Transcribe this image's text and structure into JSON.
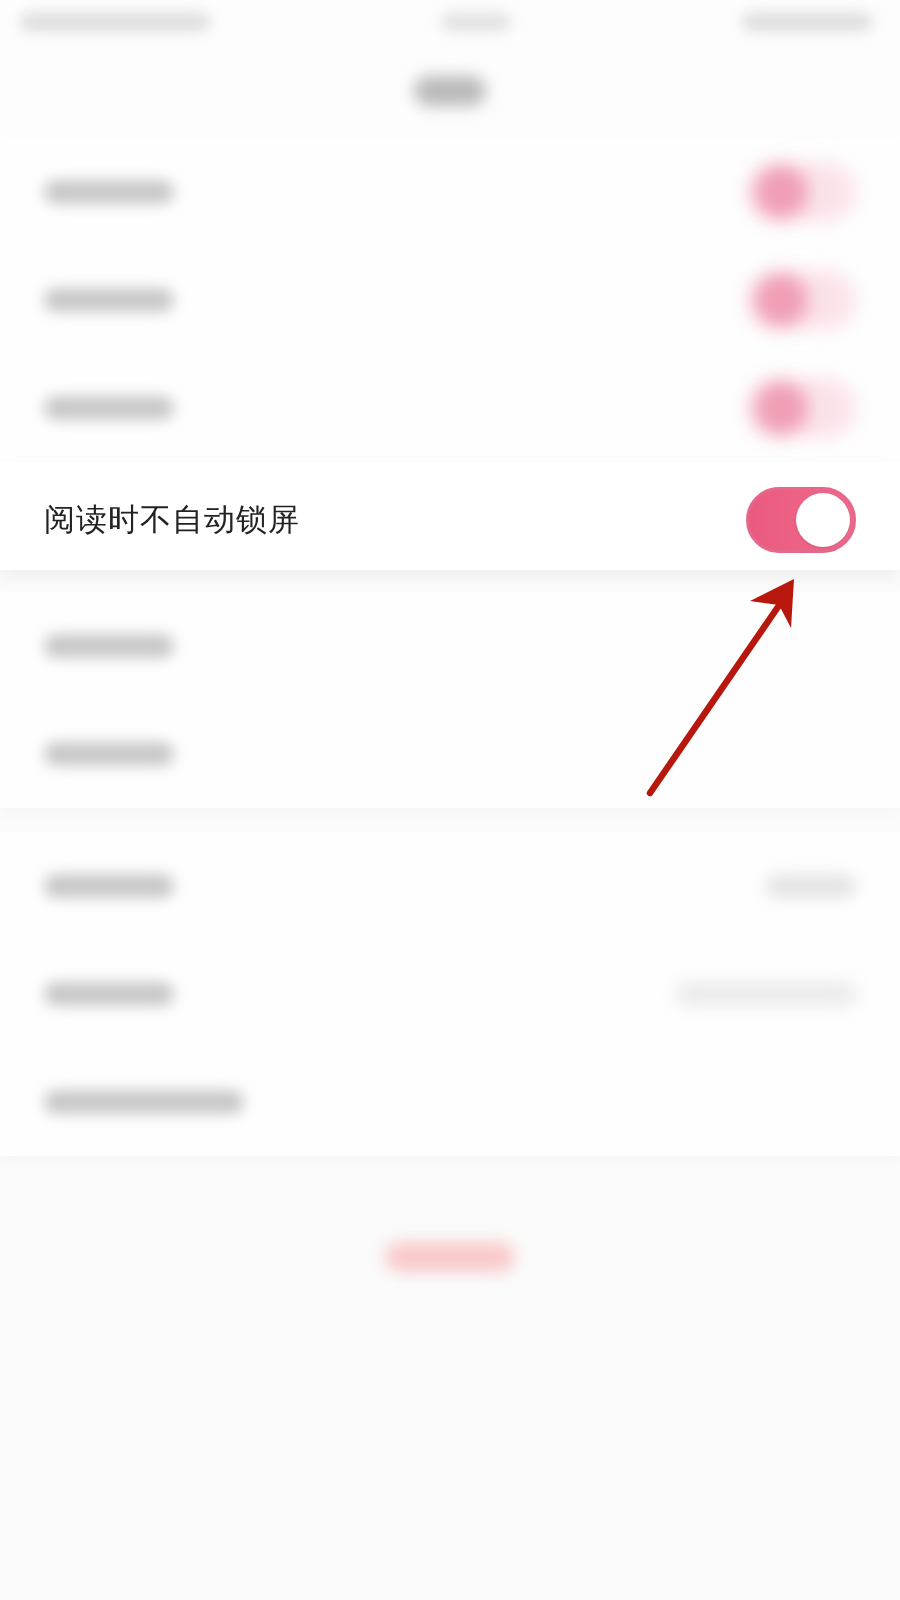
{
  "status_bar": {
    "blurred": true
  },
  "nav_bar": {
    "blurred": true
  },
  "settings_groups": [
    {
      "rows": [
        {
          "kind": "blurred_toggle"
        },
        {
          "kind": "blurred_toggle"
        },
        {
          "kind": "blurred_toggle"
        },
        {
          "kind": "toggle",
          "label": "阅读时不自动锁屏",
          "on": true
        }
      ]
    },
    {
      "rows": [
        {
          "kind": "blurred_plain"
        },
        {
          "kind": "blurred_plain"
        }
      ]
    },
    {
      "rows": [
        {
          "kind": "blurred_value"
        },
        {
          "kind": "blurred_value_long"
        },
        {
          "kind": "blurred_plain_long"
        }
      ]
    }
  ],
  "bottom_button": {
    "blurred": true
  },
  "annotation": {
    "kind": "arrow"
  }
}
